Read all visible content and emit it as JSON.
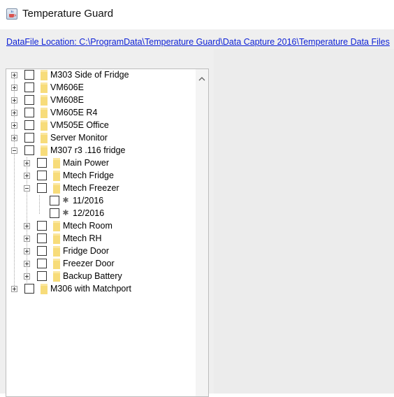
{
  "window": {
    "title": "Temperature Guard",
    "icon": "java-cup-icon"
  },
  "datafile": {
    "link_text": "DataFile Location: C:\\ProgramData\\Temperature Guard\\Data Capture 2016\\Temperature Data Files"
  },
  "tree": {
    "top_level": [
      {
        "label": "M303 Side of Fridge",
        "expanded": false
      },
      {
        "label": "VM606E",
        "expanded": false
      },
      {
        "label": "VM608E",
        "expanded": false
      },
      {
        "label": "VM605E R4",
        "expanded": false
      },
      {
        "label": "VM505E Office",
        "expanded": false
      },
      {
        "label": "Server Monitor",
        "expanded": false
      },
      {
        "label": "M307 r3 .116 fridge",
        "expanded": true
      },
      {
        "label": "M306 with Matchport",
        "expanded": false
      }
    ],
    "m307_children": [
      {
        "label": "Main Power",
        "expanded": false
      },
      {
        "label": "Mtech Fridge",
        "expanded": false
      },
      {
        "label": "Mtech Freezer",
        "expanded": true
      },
      {
        "label": "Mtech Room",
        "expanded": false
      },
      {
        "label": "Mtech RH",
        "expanded": false
      },
      {
        "label": "Fridge Door",
        "expanded": false
      },
      {
        "label": "Freezer Door",
        "expanded": false
      },
      {
        "label": "Backup Battery",
        "expanded": false
      }
    ],
    "freezer_children": [
      {
        "label": "11/2016",
        "icon": "leaf-dot-icon"
      },
      {
        "label": "12/2016",
        "icon": "leaf-dot-icon"
      }
    ]
  },
  "colors": {
    "link": "#0b1fd6",
    "folder": "#f7dc7a",
    "panel_bg": "#efefef"
  }
}
